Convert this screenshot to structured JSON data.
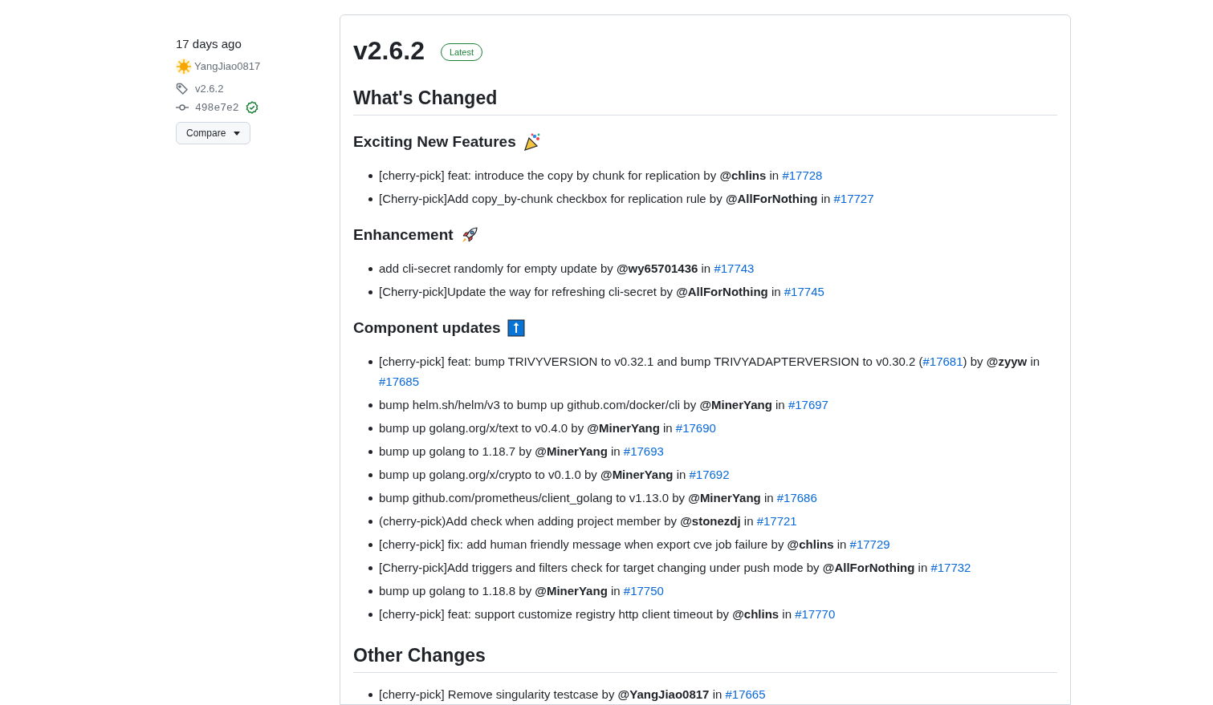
{
  "sidebar": {
    "time": "17 days ago",
    "author": "YangJiao0817",
    "tag": "v2.6.2",
    "commit": "498e7e2",
    "verified": true,
    "compare_button": "Compare"
  },
  "release": {
    "title": "v2.6.2",
    "badge": "Latest",
    "sections": [
      {
        "kind": "h2",
        "title": "What's Changed"
      },
      {
        "kind": "h3",
        "title": "Exciting New Features",
        "items": [
          [
            {
              "kind": "text",
              "text": "[cherry-pick] feat: introduce the copy by chunk for replication by "
            },
            {
              "kind": "user",
              "text": "@chlins"
            },
            {
              "kind": "text",
              "text": " in "
            },
            {
              "kind": "link",
              "text": "#17728"
            }
          ],
          [
            {
              "kind": "text",
              "text": "[Cherry-pick]Add copy_by-chunk checkbox for replication rule by "
            },
            {
              "kind": "user",
              "text": "@AllForNothing"
            },
            {
              "kind": "text",
              "text": " in "
            },
            {
              "kind": "link",
              "text": "#17727"
            }
          ]
        ]
      },
      {
        "kind": "h3",
        "title": "Enhancement",
        "items": [
          [
            {
              "kind": "text",
              "text": "add cli-secret randomly for empty update by "
            },
            {
              "kind": "user",
              "text": "@wy65701436"
            },
            {
              "kind": "text",
              "text": " in "
            },
            {
              "kind": "link",
              "text": "#17743"
            }
          ],
          [
            {
              "kind": "text",
              "text": "[Cherry-pick]Update the way for refreshing cli-secret by "
            },
            {
              "kind": "user",
              "text": "@AllForNothing"
            },
            {
              "kind": "text",
              "text": " in "
            },
            {
              "kind": "link",
              "text": "#17745"
            }
          ]
        ]
      },
      {
        "kind": "h3",
        "title": "Component updates",
        "items": [
          [
            {
              "kind": "text",
              "text": "[cherry-pick] feat: bump TRIVYVERSION to v0.32.1 and bump TRIVYADAPTERVERSION to v0.30.2 ("
            },
            {
              "kind": "link",
              "text": "#17681"
            },
            {
              "kind": "text",
              "text": ") by "
            },
            {
              "kind": "user",
              "text": "@zyyw"
            },
            {
              "kind": "text",
              "text": " in "
            },
            {
              "kind": "link",
              "text": "#17685"
            }
          ],
          [
            {
              "kind": "text",
              "text": "bump helm.sh/helm/v3 to bump up github.com/docker/cli by "
            },
            {
              "kind": "user",
              "text": "@MinerYang"
            },
            {
              "kind": "text",
              "text": " in "
            },
            {
              "kind": "link",
              "text": "#17697"
            }
          ],
          [
            {
              "kind": "text",
              "text": "bump up golang.org/x/text to v0.4.0 by "
            },
            {
              "kind": "user",
              "text": "@MinerYang"
            },
            {
              "kind": "text",
              "text": " in "
            },
            {
              "kind": "link",
              "text": "#17690"
            }
          ],
          [
            {
              "kind": "text",
              "text": "bump up golang to 1.18.7 by "
            },
            {
              "kind": "user",
              "text": "@MinerYang"
            },
            {
              "kind": "text",
              "text": " in "
            },
            {
              "kind": "link",
              "text": "#17693"
            }
          ],
          [
            {
              "kind": "text",
              "text": "bump up golang.org/x/crypto to v0.1.0 by "
            },
            {
              "kind": "user",
              "text": "@MinerYang"
            },
            {
              "kind": "text",
              "text": " in "
            },
            {
              "kind": "link",
              "text": "#17692"
            }
          ],
          [
            {
              "kind": "text",
              "text": "bump github.com/prometheus/client_golang to v1.13.0 by "
            },
            {
              "kind": "user",
              "text": "@MinerYang"
            },
            {
              "kind": "text",
              "text": " in "
            },
            {
              "kind": "link",
              "text": "#17686"
            }
          ],
          [
            {
              "kind": "text",
              "text": "(cherry-pick)Add check when adding project member by "
            },
            {
              "kind": "user",
              "text": "@stonezdj"
            },
            {
              "kind": "text",
              "text": " in "
            },
            {
              "kind": "link",
              "text": "#17721"
            }
          ],
          [
            {
              "kind": "text",
              "text": "[cherry-pick] fix: add human friendly message when export cve job failure by "
            },
            {
              "kind": "user",
              "text": "@chlins"
            },
            {
              "kind": "text",
              "text": " in "
            },
            {
              "kind": "link",
              "text": "#17729"
            }
          ],
          [
            {
              "kind": "text",
              "text": "[Cherry-pick]Add triggers and filters check for target changing under push mode by "
            },
            {
              "kind": "user",
              "text": "@AllForNothing"
            },
            {
              "kind": "text",
              "text": " in "
            },
            {
              "kind": "link",
              "text": "#17732"
            }
          ],
          [
            {
              "kind": "text",
              "text": "bump up golang to 1.18.8 by "
            },
            {
              "kind": "user",
              "text": "@MinerYang"
            },
            {
              "kind": "text",
              "text": " in "
            },
            {
              "kind": "link",
              "text": "#17750"
            }
          ],
          [
            {
              "kind": "text",
              "text": "[cherry-pick] feat: support customize registry http client timeout by "
            },
            {
              "kind": "user",
              "text": "@chlins"
            },
            {
              "kind": "text",
              "text": " in "
            },
            {
              "kind": "link",
              "text": "#17770"
            }
          ]
        ]
      },
      {
        "kind": "h2",
        "title": "Other Changes",
        "items": [
          [
            {
              "kind": "text",
              "text": "[cherry-pick] Remove singularity testcase by "
            },
            {
              "kind": "user",
              "text": "@YangJiao0817"
            },
            {
              "kind": "text",
              "text": " in "
            },
            {
              "kind": "link",
              "text": "#17665"
            }
          ]
        ]
      }
    ]
  }
}
